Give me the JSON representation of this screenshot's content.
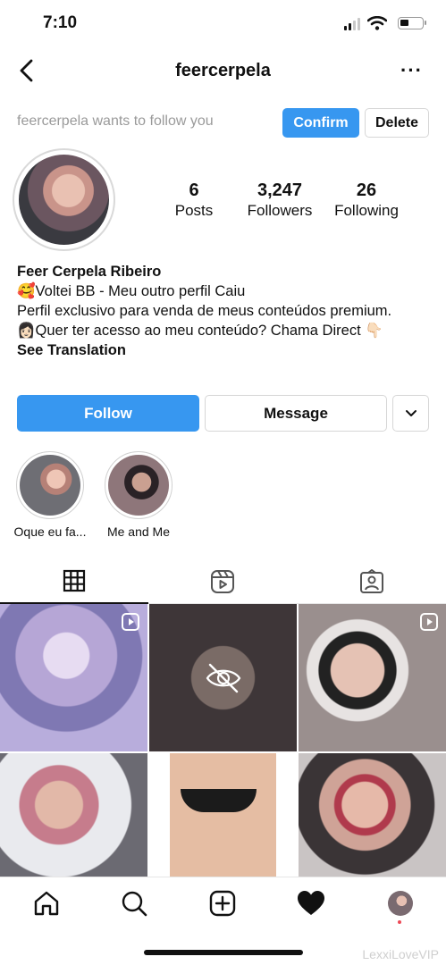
{
  "status": {
    "time": "7:10"
  },
  "header": {
    "username": "feercerpela"
  },
  "follow_request": {
    "text": "feercerpela wants to follow you",
    "confirm_label": "Confirm",
    "delete_label": "Delete"
  },
  "stats": {
    "posts_count": "6",
    "posts_label": "Posts",
    "followers_count": "3,247",
    "followers_label": "Followers",
    "following_count": "26",
    "following_label": "Following"
  },
  "bio": {
    "name": "Feer Cerpela Ribeiro",
    "line1": "🥰Voltei BB - Meu outro perfil Caiu",
    "line2": "Perfil exclusivo para venda de meus conteúdos premium.",
    "line3": "👩🏻Quer ter acesso ao meu conteúdo? Chama Direct 👇🏻",
    "see_translation": "See Translation"
  },
  "actions": {
    "follow_label": "Follow",
    "message_label": "Message"
  },
  "highlights": [
    {
      "label": "Oque eu fa..."
    },
    {
      "label": "Me and Me"
    }
  ],
  "tabs": [
    "grid-icon",
    "reels-icon",
    "tagged-icon"
  ],
  "nav": [
    "home-icon",
    "search-icon",
    "new-post-icon",
    "activity-heart-icon",
    "profile-avatar"
  ],
  "watermark": "LexxiLoveVIP",
  "colors": {
    "accent": "#3797f0",
    "notification": "#ed4956"
  }
}
